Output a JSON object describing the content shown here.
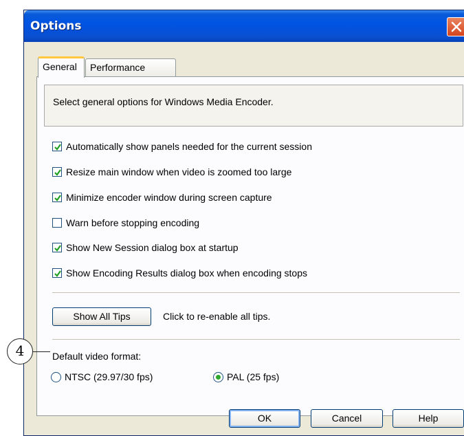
{
  "window": {
    "title": "Options",
    "close_icon": "close-icon"
  },
  "tabs": [
    {
      "label": "General",
      "selected": true
    },
    {
      "label": "Performance",
      "selected": false
    }
  ],
  "description": "Select general options for Windows Media Encoder.",
  "options": [
    {
      "label": "Automatically show panels needed for the current session",
      "checked": true
    },
    {
      "label": "Resize main window when video is zoomed too large",
      "checked": true
    },
    {
      "label": "Minimize encoder window during screen capture",
      "checked": true
    },
    {
      "label": "Warn before stopping encoding",
      "checked": false
    },
    {
      "label": "Show New Session dialog box at startup",
      "checked": true
    },
    {
      "label": "Show Encoding Results dialog box when encoding stops",
      "checked": true
    }
  ],
  "tips": {
    "button_label": "Show All Tips",
    "hint": "Click to re-enable all tips."
  },
  "video_format": {
    "label": "Default video format:",
    "options": [
      {
        "label": "NTSC (29.97/30 fps)",
        "selected": false
      },
      {
        "label": "PAL (25 fps)",
        "selected": true
      }
    ]
  },
  "buttons": {
    "ok": "OK",
    "cancel": "Cancel",
    "help": "Help"
  },
  "callout": {
    "number": "4"
  },
  "colors": {
    "titlebar": "#0054e3",
    "dialog_bg": "#ece9d8",
    "check": "#21a121",
    "close": "#d5441d"
  }
}
